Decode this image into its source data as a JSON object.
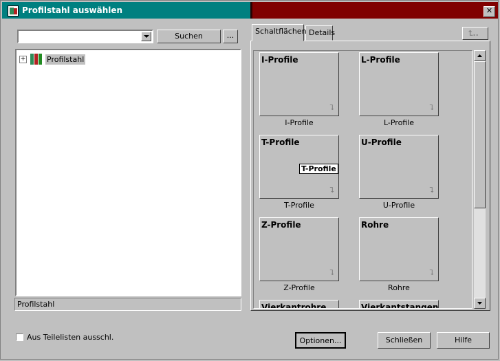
{
  "window": {
    "title": "Profilstahl auswählen",
    "close_glyph": "✕"
  },
  "search": {
    "value": "",
    "button": "Suchen",
    "more_button": "..."
  },
  "tree": {
    "items": [
      {
        "expander": "+",
        "label": "Profilstahl"
      }
    ]
  },
  "status_text": "Profilstahl",
  "tabs": [
    "Schaltflächen",
    "Details"
  ],
  "up_button_glyph": "⮤..",
  "tiles": [
    {
      "title": "I-Profile",
      "caption": "I-Profile"
    },
    {
      "title": "L-Profile",
      "caption": "L-Profile"
    },
    {
      "title": "T-Profile",
      "caption": "T-Profile"
    },
    {
      "title": "U-Profile",
      "caption": "U-Profile"
    },
    {
      "title": "Z-Profile",
      "caption": "Z-Profile"
    },
    {
      "title": "Rohre",
      "caption": "Rohre"
    },
    {
      "title": "Vierkantrohre",
      "caption": ""
    },
    {
      "title": "Vierkantstangen",
      "caption": ""
    }
  ],
  "tooltip": "T-Profile",
  "tile_arrow_glyph": "⮧",
  "checkbox": {
    "label": "Aus Teilelisten ausschl.",
    "checked": false
  },
  "buttons": {
    "options": "Optionen...",
    "close": "Schließen",
    "help": "Hilfe"
  },
  "colors": {
    "title_left": "#008080",
    "title_right": "#800000"
  }
}
